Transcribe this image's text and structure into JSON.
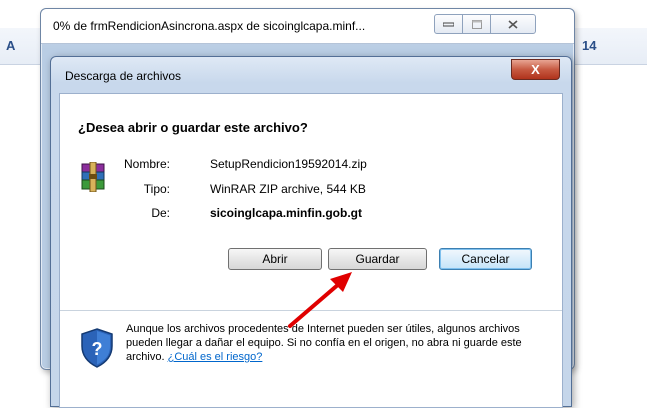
{
  "background": {
    "left_fragment": "A",
    "right_fragment": "14"
  },
  "progress_window": {
    "title": "0% de frmRendicionAsincrona.aspx de sicoinglcapa.minf..."
  },
  "dialog": {
    "title": "Descarga de archivos",
    "close_glyph": "X",
    "question": "¿Desea abrir o guardar este archivo?",
    "file_icon": "winrar-archive-icon",
    "rows": [
      {
        "label": "Nombre:",
        "value": "SetupRendicion19592014.zip"
      },
      {
        "label": "Tipo:",
        "value": "WinRAR ZIP archive, 544 KB"
      },
      {
        "label": "De:",
        "value": "sicoinglcapa.minfin.gob.gt"
      }
    ],
    "buttons": {
      "open": "Abrir",
      "save": "Guardar",
      "cancel": "Cancelar"
    },
    "warning_text": "Aunque los archivos procedentes de Internet pueden ser útiles, algunos archivos pueden llegar a dañar el equipo. Si no confía en el origen, no abra ni guarde este archivo.",
    "warning_link": "¿Cuál es el riesgo?",
    "shield_icon": "security-shield-icon"
  },
  "colors": {
    "annotation_arrow": "#e00000",
    "link": "#0066cc"
  }
}
